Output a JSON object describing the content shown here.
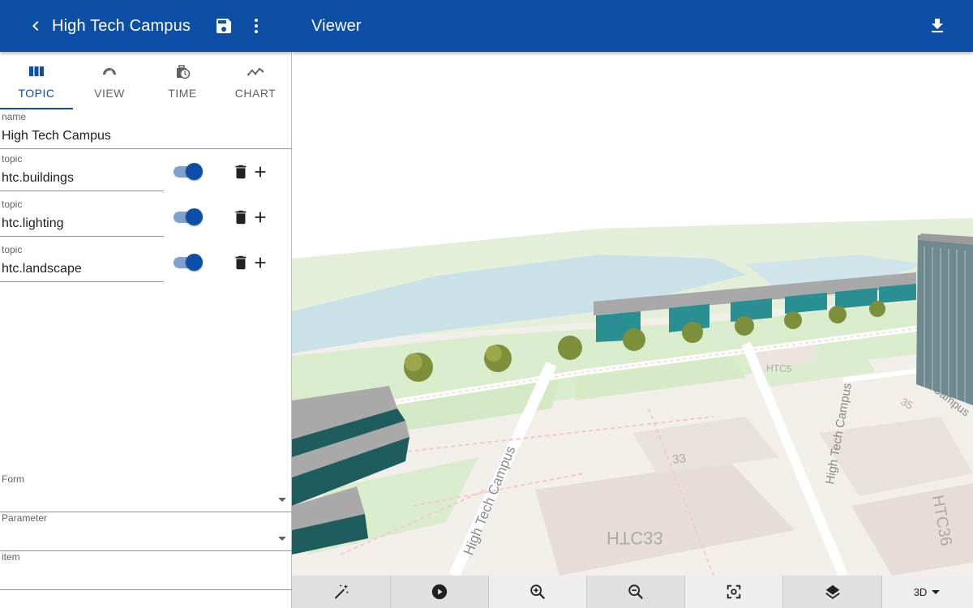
{
  "left_panel": {
    "header": {
      "title": "High Tech Campus",
      "back_icon": "chevron-left-icon",
      "save_icon": "floppy-disk-icon",
      "menu_icon": "more-vertical-icon"
    },
    "tabs": [
      {
        "label": "TOPIC",
        "icon": "view-columns-icon",
        "active": true
      },
      {
        "label": "VIEW",
        "icon": "speedometer-icon",
        "active": false
      },
      {
        "label": "TIME",
        "icon": "time-lapse-bag-icon",
        "active": false
      },
      {
        "label": "CHART",
        "icon": "line-chart-icon",
        "active": false
      }
    ],
    "name_field": {
      "label": "name",
      "value": "High Tech Campus"
    },
    "topics": [
      {
        "label": "topic",
        "value": "htc.buildings",
        "enabled": true
      },
      {
        "label": "topic",
        "value": "htc.lighting",
        "enabled": true
      },
      {
        "label": "topic",
        "value": "htc.landscape",
        "enabled": true
      }
    ],
    "form_select": {
      "label": "Form",
      "value": ""
    },
    "parameter_select": {
      "label": "Parameter",
      "value": ""
    },
    "item_field": {
      "label": "item",
      "value": ""
    }
  },
  "viewer": {
    "title": "Viewer",
    "download_icon": "download-icon",
    "map_labels": [
      "High Tech Campus",
      "High Tech Campus",
      "HTC33",
      "HTC36",
      "33",
      "35",
      "HTC5",
      "Campus"
    ],
    "toolbar": {
      "buttons": [
        "magic-wand-icon",
        "play-circle-icon",
        "zoom-in-icon",
        "zoom-out-icon",
        "center-focus-icon",
        "layers-icon"
      ],
      "mode_label": "3D"
    },
    "colors": {
      "app_bar": "#0d4ea6",
      "building_teal": "#2a8f93",
      "roof_gray": "#a8a8a8",
      "water": "#c9e2e8",
      "grass": "#d9eccc"
    }
  }
}
